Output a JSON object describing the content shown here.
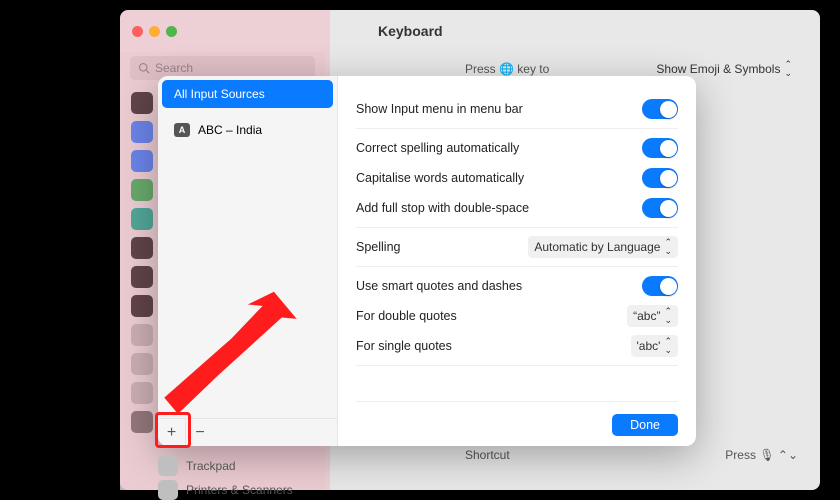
{
  "window": {
    "title": "Keyboard"
  },
  "search": {
    "placeholder": "Search"
  },
  "bg": {
    "press_prefix": "Press",
    "press_suffix": "key to",
    "emoji_label": "Show Emoji & Symbols",
    "shortcut_label": "Shortcut",
    "shortcut_value": "Press",
    "trackpad": "Trackpad",
    "printers": "Printers & Scanners"
  },
  "sheet": {
    "sources": {
      "all_label": "All Input Sources",
      "items": [
        {
          "key": "A",
          "label": "ABC – India"
        }
      ]
    },
    "options": {
      "show_menu": "Show Input menu in menu bar",
      "correct_spelling": "Correct spelling automatically",
      "capitalise": "Capitalise words automatically",
      "full_stop": "Add full stop with double-space",
      "spelling_label": "Spelling",
      "spelling_value": "Automatic by Language",
      "smart_quotes": "Use smart quotes and dashes",
      "double_quotes_label": "For double quotes",
      "double_quotes_value": "“abc”",
      "single_quotes_label": "For single quotes",
      "single_quotes_value": "'abc'"
    },
    "done": "Done",
    "plus": "+",
    "minus": "−"
  }
}
